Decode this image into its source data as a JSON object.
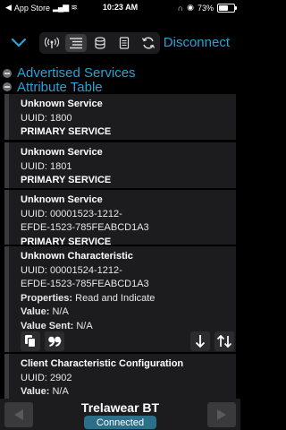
{
  "status_bar": {
    "back_app": "App Store",
    "time": "10:23 AM",
    "battery_text": "73%",
    "battery_level": 0.73
  },
  "toolbar": {
    "disconnect_label": "Disconnect",
    "icons": [
      "radio-waves-icon",
      "list-icon",
      "database-icon",
      "document-icon",
      "refresh-icon"
    ]
  },
  "sections": {
    "advertised": "Advertised Services",
    "attribute_table": "Attribute Table"
  },
  "items": [
    {
      "title": "Unknown Service",
      "uuid": "UUID: 1800",
      "type": "PRIMARY SERVICE"
    },
    {
      "title": "Unknown Service",
      "uuid": "UUID: 1801",
      "type": "PRIMARY SERVICE"
    },
    {
      "title": "Unknown Service",
      "uuid_line1": "UUID: 00001523-1212-",
      "uuid_line2": "EFDE-1523-785FEABCD1A3",
      "type": "PRIMARY SERVICE"
    }
  ],
  "characteristic": {
    "title": "Unknown Characteristic",
    "uuid_line1": "UUID: 00001524-1212-",
    "uuid_line2": "EFDE-1523-785FEABCD1A3",
    "properties_label": "Properties:",
    "properties": "Read and Indicate",
    "value_label": "Value:",
    "value": "N/A",
    "sent_label": "Value Sent:",
    "sent": "N/A"
  },
  "descriptor": {
    "title": "Client Characteristic Configuration",
    "uuid": "UUID: 2902",
    "value_label": "Value:",
    "value": "N/A"
  },
  "bottom": {
    "device_name": "Trelawear BT",
    "status": "Connected"
  }
}
